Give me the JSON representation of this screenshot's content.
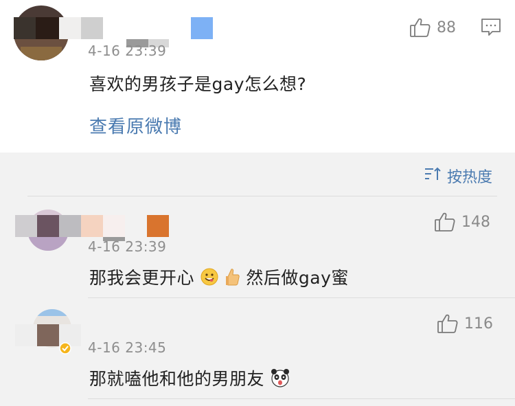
{
  "post": {
    "timestamp": "4-16 23:39",
    "text": "喜欢的男孩子是gay怎么想?",
    "like_count": "88",
    "view_original_label": "查看原微博",
    "like_icon": "thumbs-up-icon",
    "comment_icon": "comment-icon"
  },
  "sort": {
    "label": "按热度",
    "icon": "sort-icon"
  },
  "comments": [
    {
      "timestamp": "4-16 23:39",
      "text_part1": "那我会更开心",
      "emoji1": "grin-emoji-icon",
      "emoji2": "thumbs-up-emoji-icon",
      "text_part2": "然后做gay蜜",
      "like_count": "148"
    },
    {
      "timestamp": "4-16 23:45",
      "text": "那就嗑他和他的男朋友",
      "emoji": "panda-emoji-icon",
      "like_count": "116"
    }
  ],
  "colors": {
    "link": "#4a7ab0",
    "background": "#f2f2f2",
    "card": "#ffffff"
  }
}
